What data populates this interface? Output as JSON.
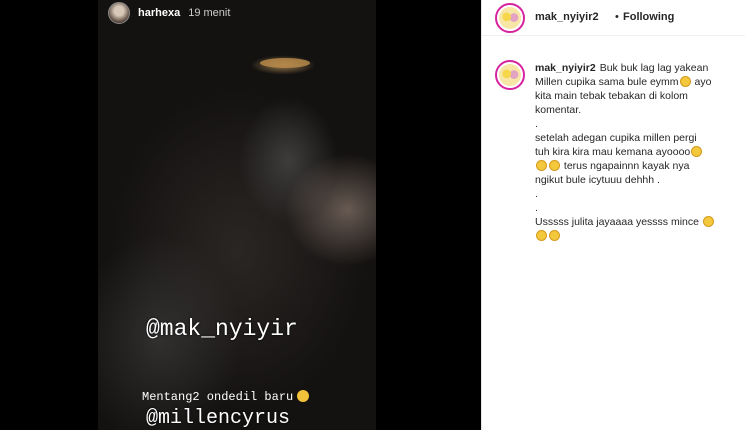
{
  "story": {
    "username": "harhexa",
    "time_ago": "19 menit",
    "tag_handle": "@mak_nyiyir",
    "caption": "Mentang2 ondedil baru",
    "mention": "@millencyrus"
  },
  "post_header": {
    "username": "mak_nyiyir2",
    "separator": "•",
    "follow_status": "Following"
  },
  "caption_comment": {
    "username": "mak_nyiyir2",
    "lines": [
      "Buk buk lag lag yakean",
      "Millen cupika sama bule eymm",
      "kita main tebak tebakan di kolom",
      "komentar.",
      ".",
      "setelah adegan cupika millen pergi",
      "tuh kira kira mau kemana ayoooo",
      "terus ngapainnn kayak nya",
      "ngikut bule icytuuu dehhh .",
      ".",
      ".",
      "Usssss julita jayaaaa yessss mince"
    ],
    "line2_suffix": "ayo"
  },
  "colors": {
    "text": "#262626",
    "story_ring": "#d6249f",
    "emoji": "#f4c83c"
  },
  "icons": [
    "grinning-squint-emoji",
    "laughing-emoji",
    "avatar-cartoon"
  ]
}
